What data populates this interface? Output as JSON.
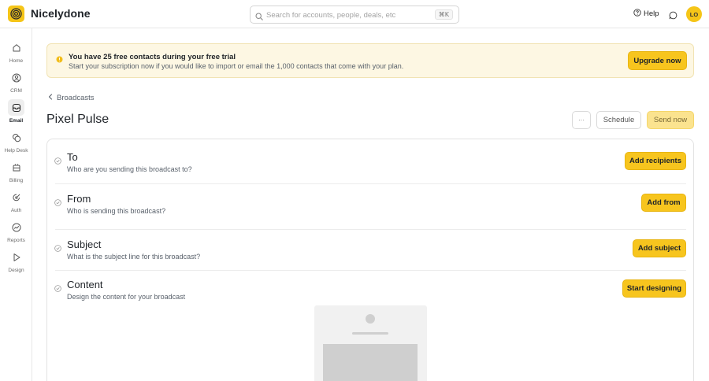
{
  "app": {
    "name": "Nicelydone"
  },
  "search": {
    "placeholder": "Search for accounts, people, deals, etc",
    "shortcut": "⌘K"
  },
  "header": {
    "help_label": "Help",
    "avatar_initials": "LO"
  },
  "sidebar": {
    "items": [
      {
        "label": "Home",
        "icon": "home-icon"
      },
      {
        "label": "CRM",
        "icon": "crm-icon"
      },
      {
        "label": "Email",
        "icon": "email-icon",
        "active": true
      },
      {
        "label": "Help Desk",
        "icon": "help-desk-icon"
      },
      {
        "label": "Billing",
        "icon": "billing-icon"
      },
      {
        "label": "Auth",
        "icon": "auth-icon"
      },
      {
        "label": "Reports",
        "icon": "reports-icon"
      },
      {
        "label": "Design",
        "icon": "design-icon"
      }
    ]
  },
  "banner": {
    "title": "You have 25 free contacts during your free trial",
    "text": "Start your subscription now if you would like to import or email the 1,000 contacts that come with your plan.",
    "button": "Upgrade now"
  },
  "breadcrumb": {
    "label": "Broadcasts"
  },
  "page": {
    "title": "Pixel Pulse",
    "more_label": "···",
    "schedule_label": "Schedule",
    "send_label": "Send now"
  },
  "sections": [
    {
      "title": "To",
      "description": "Who are you sending this broadcast to?",
      "button": "Add recipients"
    },
    {
      "title": "From",
      "description": "Who is sending this broadcast?",
      "button": "Add from"
    },
    {
      "title": "Subject",
      "description": "What is the subject line for this broadcast?",
      "button": "Add subject"
    },
    {
      "title": "Content",
      "description": "Design the content for your broadcast",
      "button": "Start designing"
    }
  ],
  "colors": {
    "accent": "#f7c51e",
    "banner_bg": "#fdf7e3",
    "text": "#1f2328",
    "muted": "#59616b"
  }
}
